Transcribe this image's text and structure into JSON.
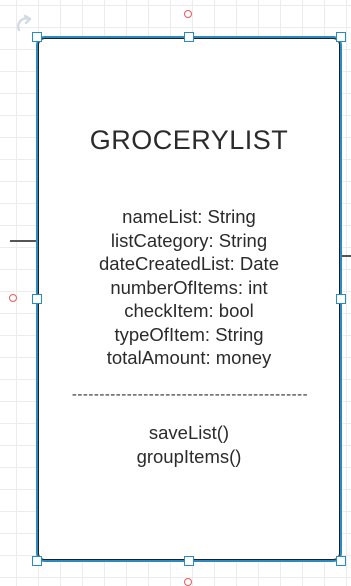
{
  "uml_class": {
    "name": "GROCERYLIST",
    "attributes": [
      "nameList: String",
      "listCategory: String",
      "dateCreatedList: Date",
      "numberOfItems: int",
      "checkItem: bool",
      "typeOfItem: String",
      "totalAmount: money"
    ],
    "divider": "-------------------------------------------",
    "operations": [
      "saveList()",
      "groupItems()"
    ]
  },
  "colors": {
    "selection": "#2a8ac4",
    "connector_point": "#ec5b5b",
    "border": "#1f1f1f",
    "text": "#2b2b2b"
  },
  "icons": {
    "rotate_handle": "rotate-arrow-icon"
  }
}
